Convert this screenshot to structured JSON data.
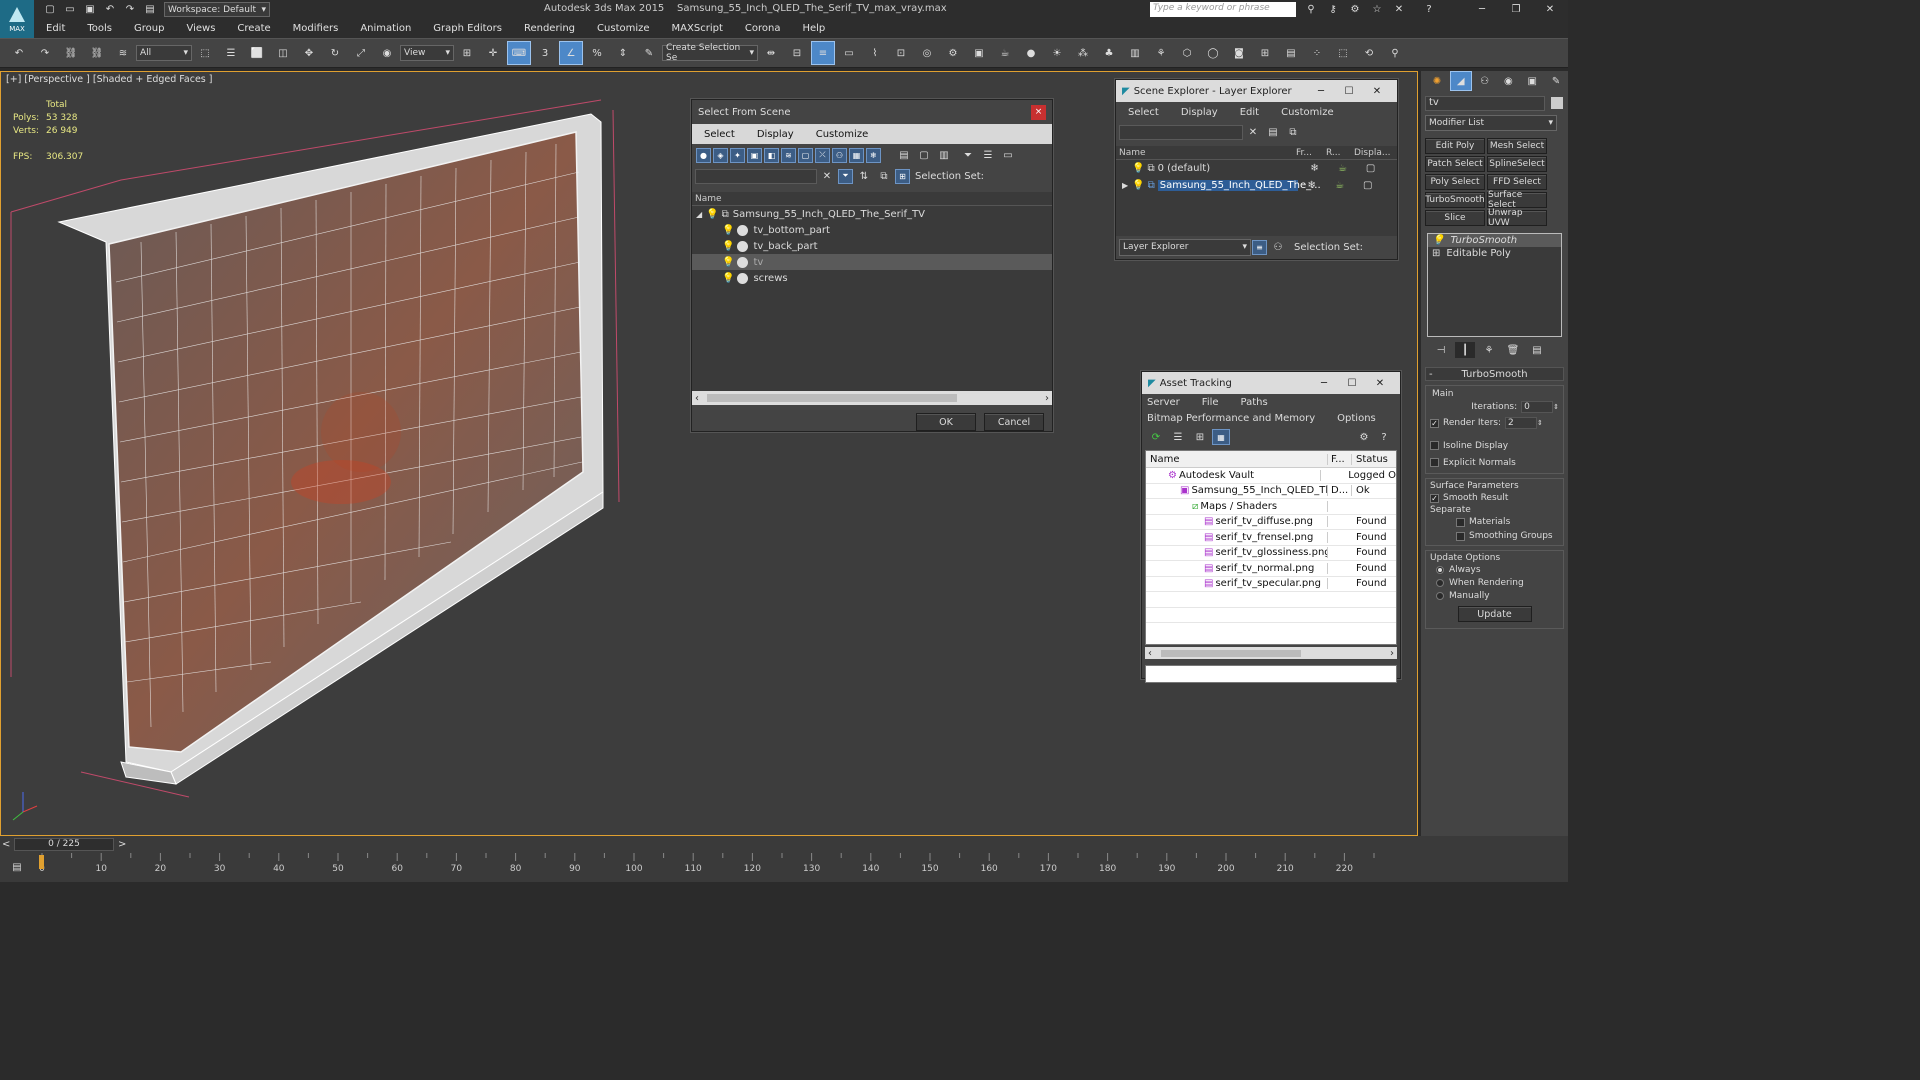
{
  "app": {
    "title": "Autodesk 3ds Max  2015",
    "file": "Samsung_55_Inch_QLED_The_Serif_TV_max_vray.max",
    "workspace": "Workspace: Default",
    "logo": "MAX",
    "search_placeholder": "Type a keyword or phrase"
  },
  "menu": [
    "Edit",
    "Tools",
    "Group",
    "Views",
    "Create",
    "Modifiers",
    "Animation",
    "Graph Editors",
    "Rendering",
    "Customize",
    "MAXScript",
    "Corona",
    "Help"
  ],
  "toolbar": {
    "filter": "All",
    "ref_coord": "View",
    "selection_set": "Create Selection Se",
    "snap_label": "3"
  },
  "viewport": {
    "label": "[+] [Perspective ] [Shaded + Edged Faces ]",
    "stats": {
      "total": "Total",
      "polys_label": "Polys:",
      "polys": "53 328",
      "verts_label": "Verts:",
      "verts": "26 949",
      "fps_label": "FPS:",
      "fps": "306.307"
    }
  },
  "select_dialog": {
    "title": "Select From Scene",
    "close": "×",
    "menu": [
      "Select",
      "Display",
      "Customize"
    ],
    "selection_set": "Selection Set:",
    "col_name": "Name",
    "root": "Samsung_55_Inch_QLED_The_Serif_TV",
    "items": [
      "tv_bottom_part",
      "tv_back_part",
      "tv",
      "screws"
    ],
    "ok": "OK",
    "cancel": "Cancel"
  },
  "scene_explorer": {
    "title": "Scene Explorer - Layer Explorer",
    "menu": [
      "Select",
      "Display",
      "Edit",
      "Customize"
    ],
    "cols": [
      "Name",
      "Fr...",
      "R...",
      "Displa..."
    ],
    "rows": [
      "0 (default)",
      "Samsung_55_Inch_QLED_The_..."
    ],
    "footer": "Layer Explorer",
    "selection_set": "Selection Set:"
  },
  "asset_tracking": {
    "title": "Asset Tracking",
    "menu": [
      "Server",
      "File",
      "Paths"
    ],
    "menu2": [
      "Bitmap Performance and Memory",
      "Options"
    ],
    "cols": [
      "Name",
      "F...",
      "Status"
    ],
    "rows": [
      {
        "name": "Autodesk Vault",
        "f": "",
        "status": "Logged O"
      },
      {
        "name": "Samsung_55_Inch_QLED_The...",
        "f": "D...",
        "status": "Ok"
      },
      {
        "name": "Maps / Shaders",
        "f": "",
        "status": ""
      },
      {
        "name": "serif_tv_diffuse.png",
        "f": "",
        "status": "Found"
      },
      {
        "name": "serif_tv_frensel.png",
        "f": "",
        "status": "Found"
      },
      {
        "name": "serif_tv_glossiness.png",
        "f": "",
        "status": "Found"
      },
      {
        "name": "serif_tv_normal.png",
        "f": "",
        "status": "Found"
      },
      {
        "name": "serif_tv_specular.png",
        "f": "",
        "status": "Found"
      }
    ]
  },
  "command_panel": {
    "object_name": "tv",
    "modifier_list": "Modifier List",
    "buttons": [
      "Edit Poly",
      "Mesh Select",
      "Patch Select",
      "SplineSelect",
      "Poly Select",
      "FFD Select",
      "TurboSmooth",
      "Surface Select",
      "Slice",
      "Unwrap UVW"
    ],
    "stack": [
      "TurboSmooth",
      "Editable Poly"
    ],
    "rollout": "TurboSmooth",
    "main": "Main",
    "iterations_label": "Iterations:",
    "iterations": "0",
    "render_iters_label": "Render Iters:",
    "render_iters": "2",
    "isoline": "Isoline Display",
    "explicit": "Explicit Normals",
    "surface_params": "Surface Parameters",
    "smooth_result": "Smooth Result",
    "separate": "Separate",
    "materials": "Materials",
    "smoothing_groups": "Smoothing Groups",
    "update_options": "Update Options",
    "always": "Always",
    "when_rendering": "When Rendering",
    "manually": "Manually",
    "update": "Update"
  },
  "timeline": {
    "frame": "0 / 225",
    "ticks": [
      "0",
      "10",
      "20",
      "30",
      "40",
      "50",
      "60",
      "70",
      "80",
      "90",
      "100",
      "110",
      "120",
      "130",
      "140",
      "150",
      "160",
      "170",
      "180",
      "190",
      "200",
      "210",
      "220"
    ]
  },
  "colors": {
    "accent": "#4d88c8",
    "viewport_border": "#e0a030",
    "wire": "#f0f0f0",
    "stats": "#e8e884",
    "selection_red": "#d04020"
  }
}
